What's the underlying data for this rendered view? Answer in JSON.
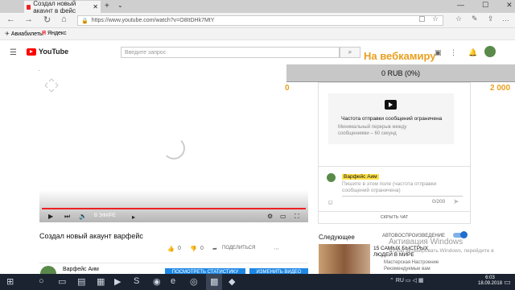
{
  "browser": {
    "tab_title": "Создал новый акаунт в фейс",
    "url": "https://www.youtube.com/watch?v=O8ItDHk7MtY",
    "favorites": [
      {
        "label": "Авиабилеты"
      },
      {
        "label": "Яндекс"
      }
    ]
  },
  "youtube": {
    "logo_text": "YouTube",
    "search_placeholder": "Введите запрос"
  },
  "overlay": {
    "webcam_text": "На вебкамиру",
    "donation_text": "0 RUB (0%)",
    "donation_min": "0",
    "donation_max": "2 000"
  },
  "player": {
    "live_label": "В ЭФИРЕ"
  },
  "chat": {
    "limit_title": "Частота отправки сообщений ограничена",
    "limit_desc": "Минимальный перерыв между сообщениями – 60 секунд",
    "username": "Варфейс Аим",
    "input_placeholder": "Пишите в этом поле (частота отправки сообщений ограничена)",
    "counter": "0/200",
    "hide_chat": "СКРЫТЬ ЧАТ"
  },
  "video": {
    "title": "Создал новый акаунт варфейс",
    "likes": "0",
    "dislikes": "0",
    "share": "ПОДЕЛИТЬСЯ",
    "channel": "Варфейс Аим",
    "stats_button": "ПОСМОТРЕТЬ СТАТИСТИКУ",
    "edit_button": "ИЗМЕНИТЬ ВИДЕО"
  },
  "sidebar": {
    "next_label": "Следующее",
    "autoplay_label": "АВТОВОСПРОИЗВЕДЕНИЕ",
    "next_title": "15 САМЫХ БЫСТРЫХ ЛЮДЕЙ В МИРЕ",
    "next_channel": "Мастерская Настроение",
    "next_meta": "Рекомендуемые вам"
  },
  "windows": {
    "activation_title": "Активация Windows",
    "activation_sub": "Чтобы активировать Windows, перейдите в",
    "lang": "RU",
    "time": "6:03",
    "date": "18.09.2018"
  },
  "colors": {
    "accent_orange": "#e8a020",
    "youtube_red": "#ff0000",
    "button_blue": "#1e88e5"
  }
}
